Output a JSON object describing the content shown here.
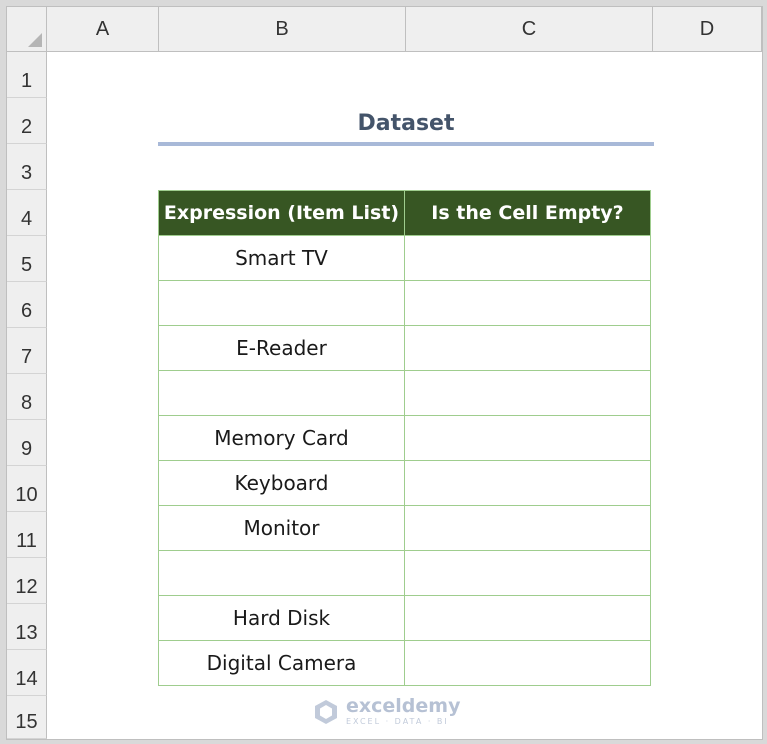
{
  "columns": [
    "A",
    "B",
    "C",
    "D"
  ],
  "rows": [
    "1",
    "2",
    "3",
    "4",
    "5",
    "6",
    "7",
    "8",
    "9",
    "10",
    "11",
    "12",
    "13",
    "14",
    "15"
  ],
  "title": "Dataset",
  "table": {
    "headers": [
      "Expression (Item List)",
      "Is the Cell Empty?"
    ],
    "items": [
      "Smart TV",
      "",
      "E-Reader",
      "",
      "Memory Card",
      "Keyboard",
      "Monitor",
      "",
      "Hard Disk",
      "Digital Camera"
    ]
  },
  "watermark": {
    "name": "exceldemy",
    "tagline": "EXCEL · DATA · BI"
  },
  "colors": {
    "header_fill": "#375623",
    "table_border": "#9fcd8e",
    "title_text": "#44546a",
    "title_rule": "#a8b9d8"
  }
}
